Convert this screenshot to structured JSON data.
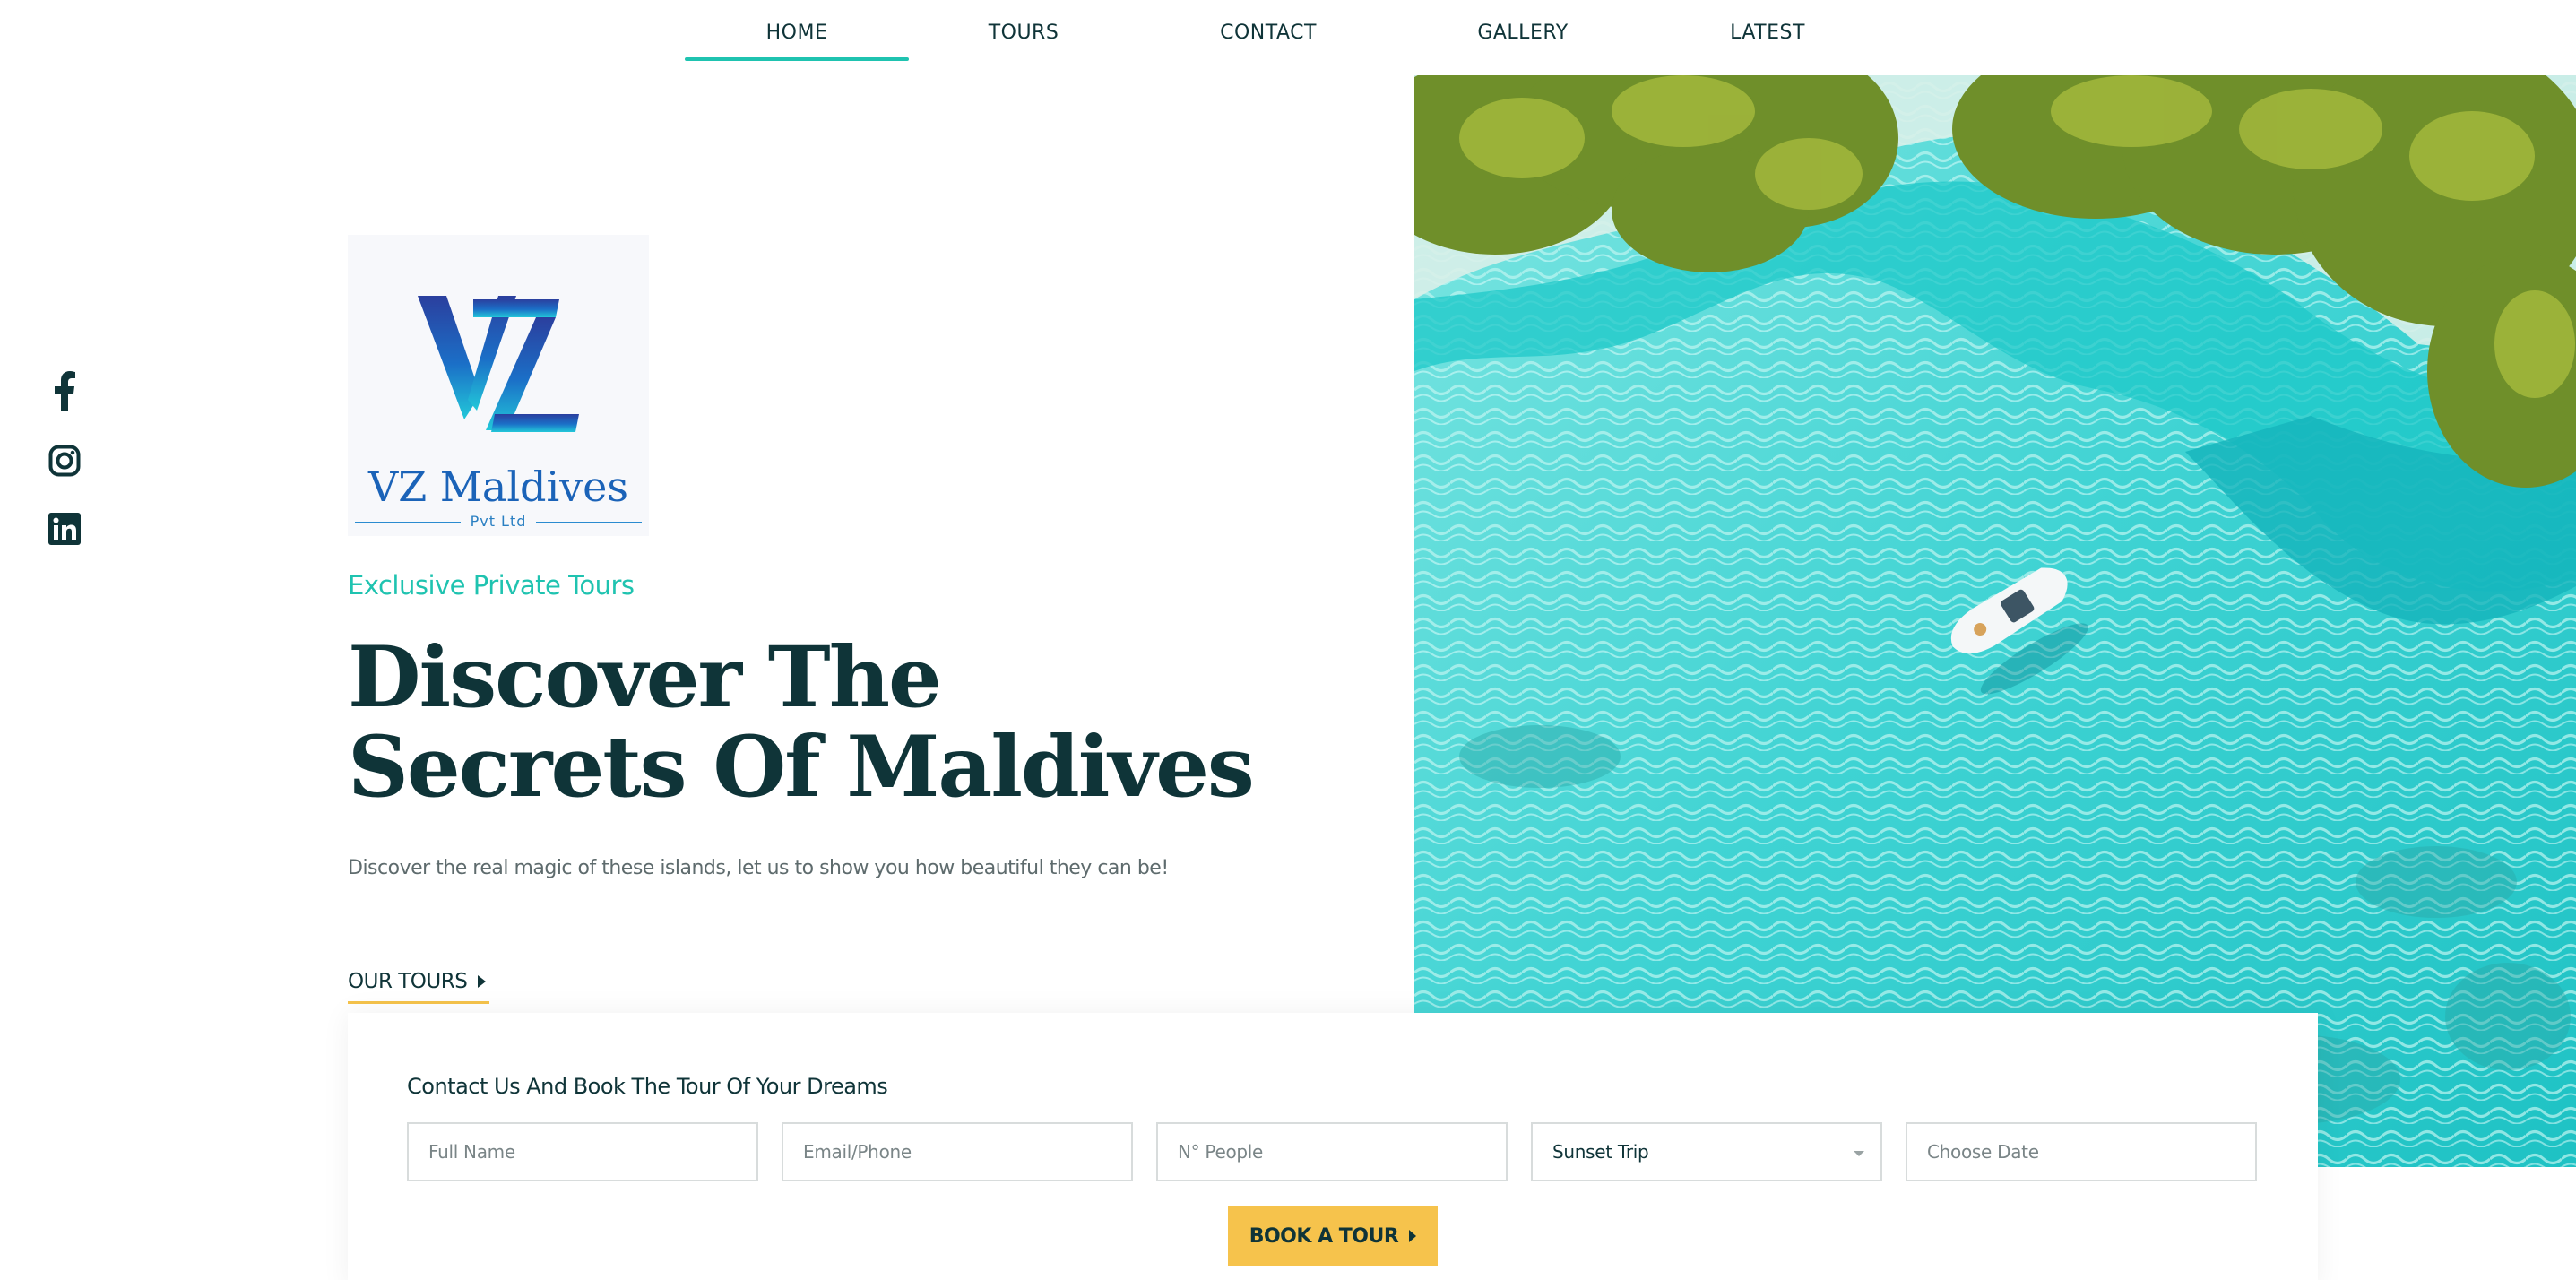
{
  "nav": {
    "items": [
      {
        "label": "HOME",
        "active": true
      },
      {
        "label": "TOURS",
        "active": false
      },
      {
        "label": "CONTACT",
        "active": false
      },
      {
        "label": "GALLERY",
        "active": false
      },
      {
        "label": "LATEST",
        "active": false
      }
    ]
  },
  "social": {
    "icons": [
      "facebook-icon",
      "instagram-icon",
      "linkedin-icon"
    ]
  },
  "logo": {
    "monogram": "VZ",
    "name": "VZ Maldives",
    "subtitle": "Pvt Ltd"
  },
  "hero": {
    "eyebrow": "Exclusive Private Tours",
    "headline_line1": "Discover The",
    "headline_line2": "Secrets Of Maldives",
    "lede": "Discover the real magic of these islands, let us to show you how beautiful they can be!",
    "cta": "OUR TOURS",
    "image": "aerial-lagoon-boat-photo"
  },
  "booking": {
    "title": "Contact Us And Book The Tour Of Your Dreams",
    "fields": {
      "full_name_placeholder": "Full Name",
      "contact_placeholder": "Email/Phone",
      "people_placeholder": "N° People",
      "trip_selected": "Sunset Trip",
      "date_placeholder": "Choose Date"
    },
    "button": "BOOK A TOUR"
  },
  "colors": {
    "accent_teal": "#1fc3b0",
    "dark_text": "#0f3438",
    "button_yellow": "#f6c34c",
    "logo_blue": "#1b63b8"
  }
}
